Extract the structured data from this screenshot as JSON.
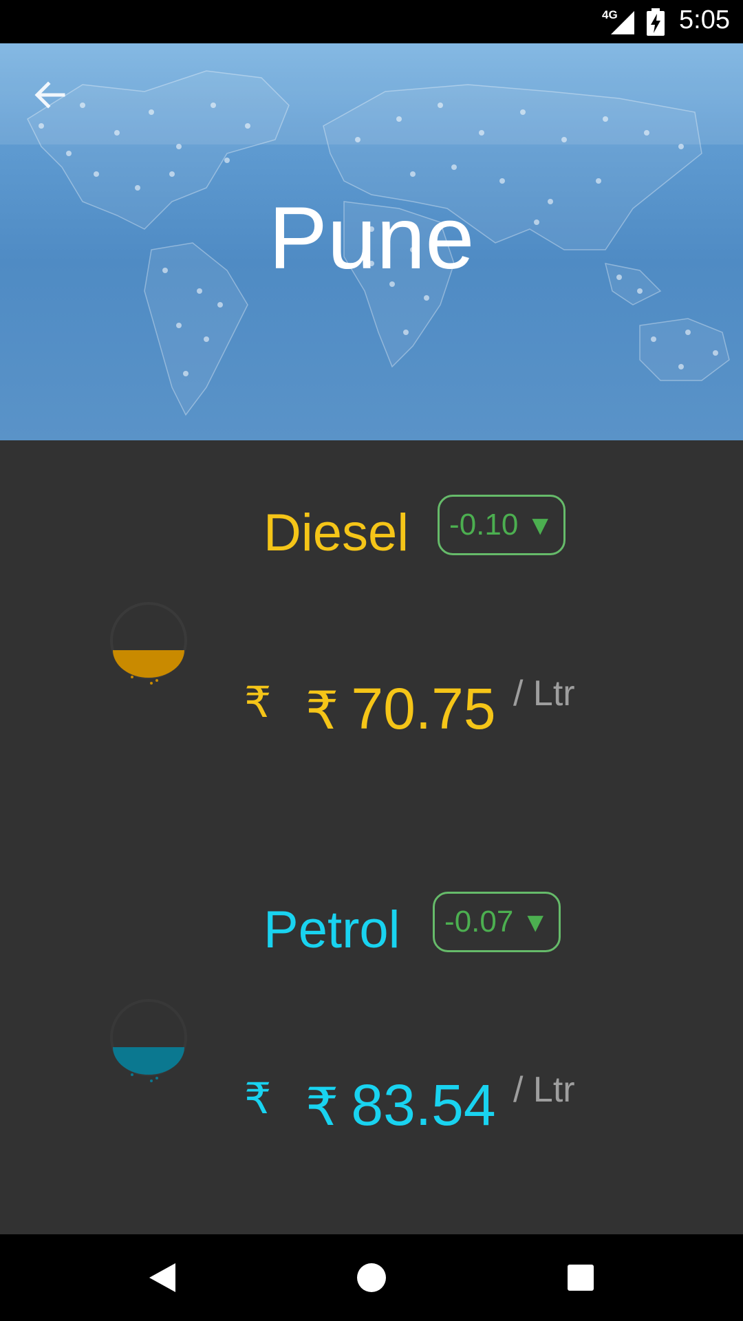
{
  "status_bar": {
    "network": "4G",
    "time": "5:05"
  },
  "header": {
    "city": "Pune",
    "back_icon": "arrow-back-icon",
    "background": "world-network-map"
  },
  "fuels": [
    {
      "name": "Diesel",
      "color": "#f5c518",
      "change": "-0.10",
      "change_direction": "down",
      "icon_rupee": "₹",
      "price": "₹ 70.75",
      "currency_symbol": "₹",
      "price_value": "70.75",
      "unit": "/ Ltr",
      "drop_color": "#c98a00",
      "drop_fill_level": 0.45
    },
    {
      "name": "Petrol",
      "color": "#19d3f0",
      "change": "-0.07",
      "change_direction": "down",
      "icon_rupee": "₹",
      "price": "₹ 83.54",
      "currency_symbol": "₹",
      "price_value": "83.54",
      "unit": "/ Ltr",
      "drop_color": "#0b7890",
      "drop_fill_level": 0.4
    }
  ],
  "colors": {
    "background": "#323232",
    "badge_border": "#66bb6a",
    "badge_text": "#4caf50",
    "unit_text": "#9e9e9e"
  },
  "nav_bar": {
    "back": "nav-back-icon",
    "home": "nav-home-icon",
    "recents": "nav-recents-icon"
  }
}
